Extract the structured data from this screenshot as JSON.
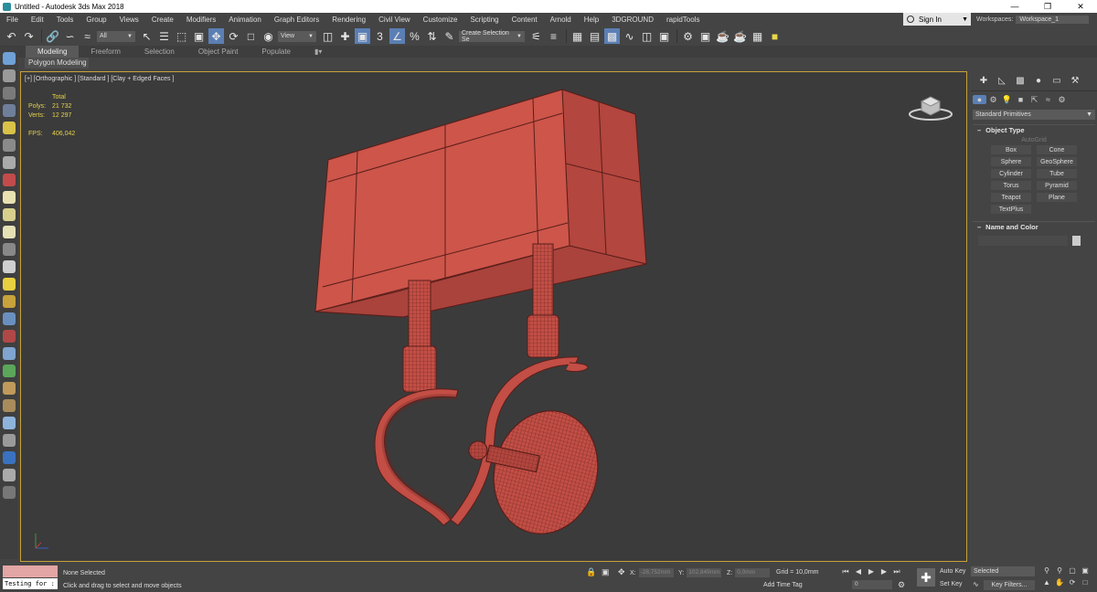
{
  "window": {
    "title": "Untitled - Autodesk 3ds Max 2018"
  },
  "menu": [
    "File",
    "Edit",
    "Tools",
    "Group",
    "Views",
    "Create",
    "Modifiers",
    "Animation",
    "Graph Editors",
    "Rendering",
    "Civil View",
    "Customize",
    "Scripting",
    "Content",
    "Arnold",
    "Help",
    "3DGROUND",
    "rapidTools"
  ],
  "account": {
    "signin": "Sign In",
    "workspaces_label": "Workspaces:",
    "workspace": "Workspace_1"
  },
  "toolbar": {
    "selection_filter": "All",
    "ref_coord": "View",
    "named_selection": "Create Selection Se",
    "snap_label": "3"
  },
  "ribbon": {
    "tabs": [
      "Modeling",
      "Freeform",
      "Selection",
      "Object Paint",
      "Populate"
    ],
    "sub": "Polygon Modeling"
  },
  "viewport": {
    "label": "[+] [Orthographic ] [Standard ] [Clay + Edged Faces ]",
    "stats": {
      "header": "Total",
      "polys_label": "Polys:",
      "polys": "21 732",
      "verts_label": "Verts:",
      "verts": "12 297",
      "fps_label": "FPS:",
      "fps": "406,042"
    },
    "colors": {
      "model_fill": "#c9534a",
      "model_edge": "#5a1e1a",
      "border": "#c8a23a"
    }
  },
  "command_panel": {
    "category": "Standard Primitives",
    "object_type_title": "Object Type",
    "autogrid": "AutoGrid",
    "buttons": [
      "Box",
      "Cone",
      "Sphere",
      "GeoSphere",
      "Cylinder",
      "Tube",
      "Torus",
      "Pyramid",
      "Teapot",
      "Plane",
      "TextPlus"
    ],
    "name_color_title": "Name and Color"
  },
  "status": {
    "script_text": "Testing for :",
    "selection": "None Selected",
    "prompt": "Click and drag to select and move objects",
    "x_label": "X:",
    "x": "-28,752mm",
    "y_label": "Y:",
    "y": "102,849mm",
    "z_label": "Z:",
    "z": "0,0mm",
    "grid": "Grid = 10,0mm",
    "add_time_tag": "Add Time Tag",
    "frame": "0",
    "auto_key": "Auto Key",
    "set_key": "Set Key",
    "selected": "Selected",
    "key_filters": "Key Filters..."
  }
}
